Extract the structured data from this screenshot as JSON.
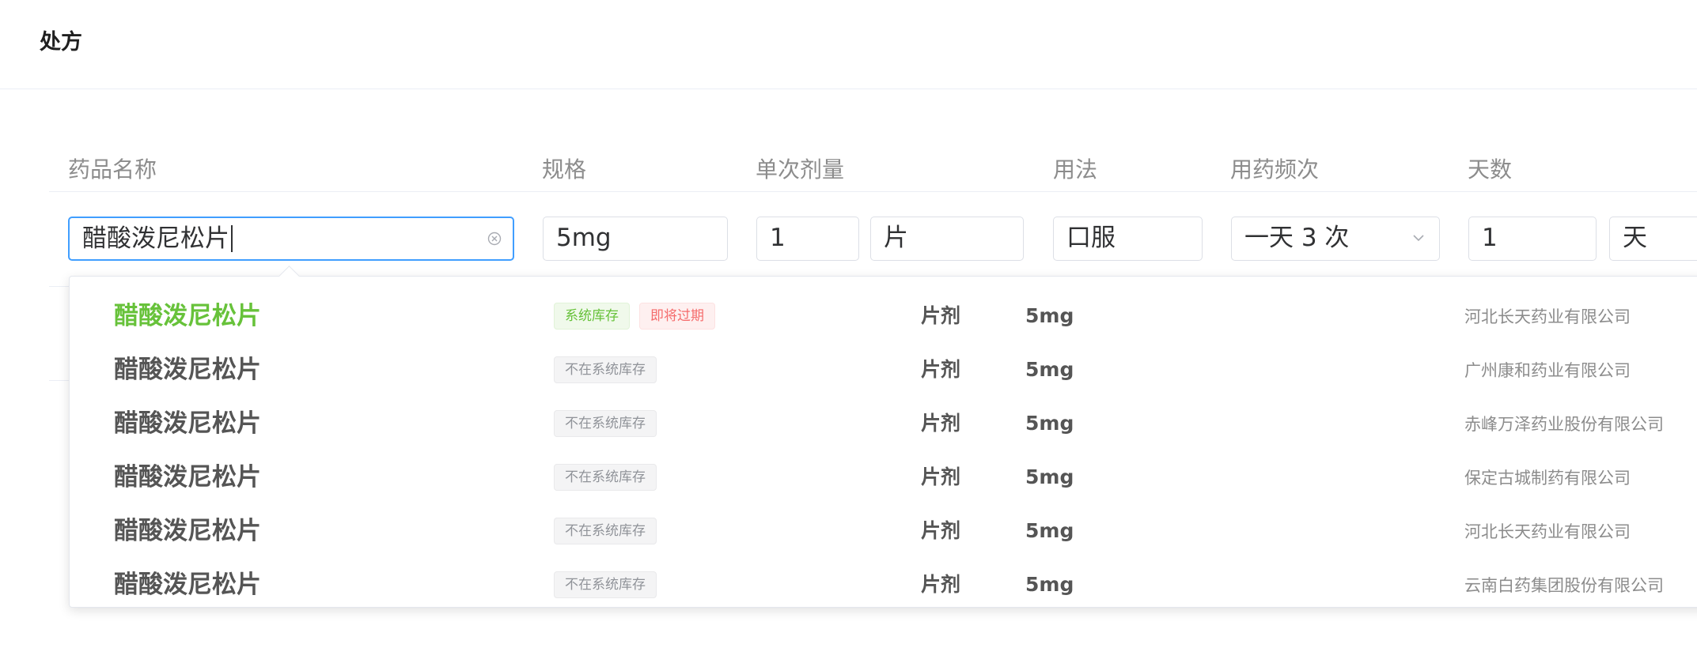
{
  "header": {
    "title": "处方"
  },
  "columns": {
    "drug_name": "药品名称",
    "spec": "规格",
    "dose": "单次剂量",
    "usage": "用法",
    "frequency": "用药频次",
    "days": "天数"
  },
  "form_row": {
    "drug_name": "醋酸泼尼松片",
    "spec": "5mg",
    "dose_value": "1",
    "dose_unit": "片",
    "usage": "口服",
    "frequency": "一天 3 次",
    "days_value": "1",
    "days_unit": "天"
  },
  "dropdown": {
    "options": [
      {
        "name": "醋酸泼尼松片",
        "tags": [
          {
            "label": "系统库存",
            "type": "green"
          },
          {
            "label": "即将过期",
            "type": "red"
          }
        ],
        "form": "片剂",
        "spec": "5mg",
        "maker": "河北长天药业有限公司"
      },
      {
        "name": "醋酸泼尼松片",
        "tags": [
          {
            "label": "不在系统库存",
            "type": "gray"
          }
        ],
        "form": "片剂",
        "spec": "5mg",
        "maker": "广州康和药业有限公司"
      },
      {
        "name": "醋酸泼尼松片",
        "tags": [
          {
            "label": "不在系统库存",
            "type": "gray"
          }
        ],
        "form": "片剂",
        "spec": "5mg",
        "maker": "赤峰万泽药业股份有限公司"
      },
      {
        "name": "醋酸泼尼松片",
        "tags": [
          {
            "label": "不在系统库存",
            "type": "gray"
          }
        ],
        "form": "片剂",
        "spec": "5mg",
        "maker": "保定古城制药有限公司"
      },
      {
        "name": "醋酸泼尼松片",
        "tags": [
          {
            "label": "不在系统库存",
            "type": "gray"
          }
        ],
        "form": "片剂",
        "spec": "5mg",
        "maker": "河北长天药业有限公司"
      },
      {
        "name": "醋酸泼尼松片",
        "tags": [
          {
            "label": "不在系统库存",
            "type": "gray"
          }
        ],
        "form": "片剂",
        "spec": "5mg",
        "maker": "云南白药集团股份有限公司"
      }
    ]
  },
  "colors": {
    "accent": "#409eff",
    "selected_text": "#67c23a",
    "tag_red": "#f56c6c",
    "tag_gray": "#909399"
  }
}
